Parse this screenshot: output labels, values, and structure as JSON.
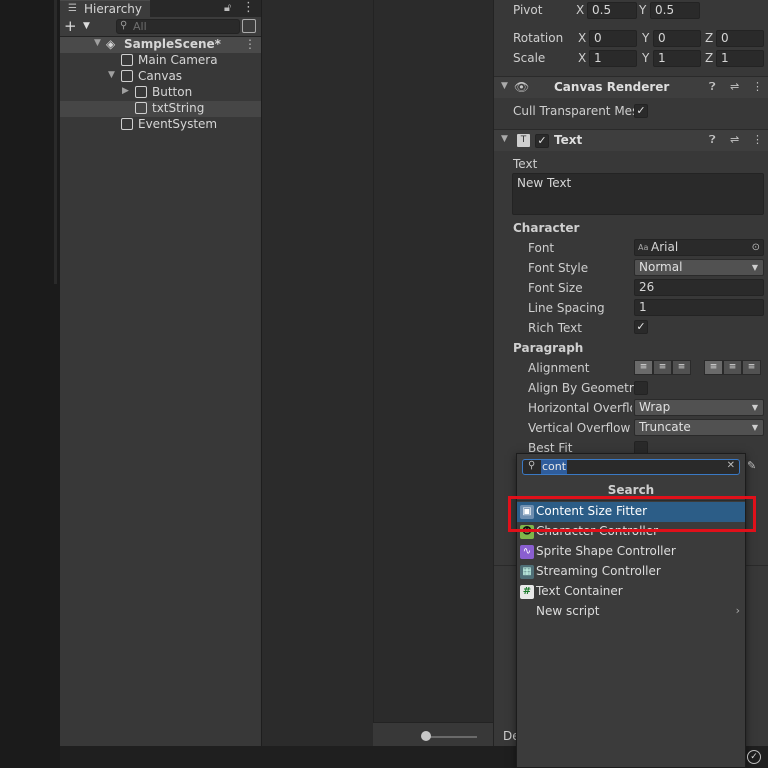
{
  "hierarchy": {
    "tab_label": "Hierarchy",
    "search_placeholder": "All",
    "items": [
      {
        "label": "SampleScene*"
      },
      {
        "label": "Main Camera"
      },
      {
        "label": "Canvas"
      },
      {
        "label": "Button"
      },
      {
        "label": "txtString"
      },
      {
        "label": "EventSystem"
      }
    ]
  },
  "inspector": {
    "pivot": {
      "label": "Pivot",
      "x": "0.5",
      "y": "0.5"
    },
    "rotation": {
      "label": "Rotation",
      "x": "0",
      "y": "0",
      "z": "0"
    },
    "scale": {
      "label": "Scale",
      "x": "1",
      "y": "1",
      "z": "1"
    },
    "axes": {
      "x": "X",
      "y": "Y",
      "z": "Z"
    },
    "canvas_renderer": {
      "title": "Canvas Renderer",
      "cull_label": "Cull Transparent Mes"
    },
    "text_component": {
      "title": "Text",
      "text_label": "Text",
      "text_value": "New Text",
      "character": "Character",
      "font_label": "Font",
      "font_value": "Arial",
      "font_prefix": "Aa",
      "font_style_label": "Font Style",
      "font_style_value": "Normal",
      "font_size_label": "Font Size",
      "font_size_value": "26",
      "line_spacing_label": "Line Spacing",
      "line_spacing_value": "1",
      "rich_text_label": "Rich Text",
      "paragraph": "Paragraph",
      "alignment_label": "Alignment",
      "align_geometry_label": "Align By Geometry",
      "h_overflow_label": "Horizontal Overflov",
      "h_overflow_value": "Wrap",
      "v_overflow_label": "Vertical Overflow",
      "v_overflow_value": "Truncate",
      "best_fit_label": "Best Fit"
    },
    "bottom_label": "De"
  },
  "popup": {
    "search_value": "cont",
    "title": "Search",
    "items": [
      {
        "label": "Content Size Fitter",
        "icon": "content-size-fitter-icon"
      },
      {
        "label": "Character Controller",
        "icon": "character-controller-icon"
      },
      {
        "label": "Sprite Shape Controller",
        "icon": "sprite-shape-icon"
      },
      {
        "label": "Streaming Controller",
        "icon": "streaming-icon"
      },
      {
        "label": "Text Container",
        "icon": "hash-icon"
      },
      {
        "label": "New script",
        "icon": ""
      }
    ]
  },
  "colors": {
    "selection": "#2c5d87",
    "highlight": "#e0101a",
    "accent": "#3a79c4"
  }
}
